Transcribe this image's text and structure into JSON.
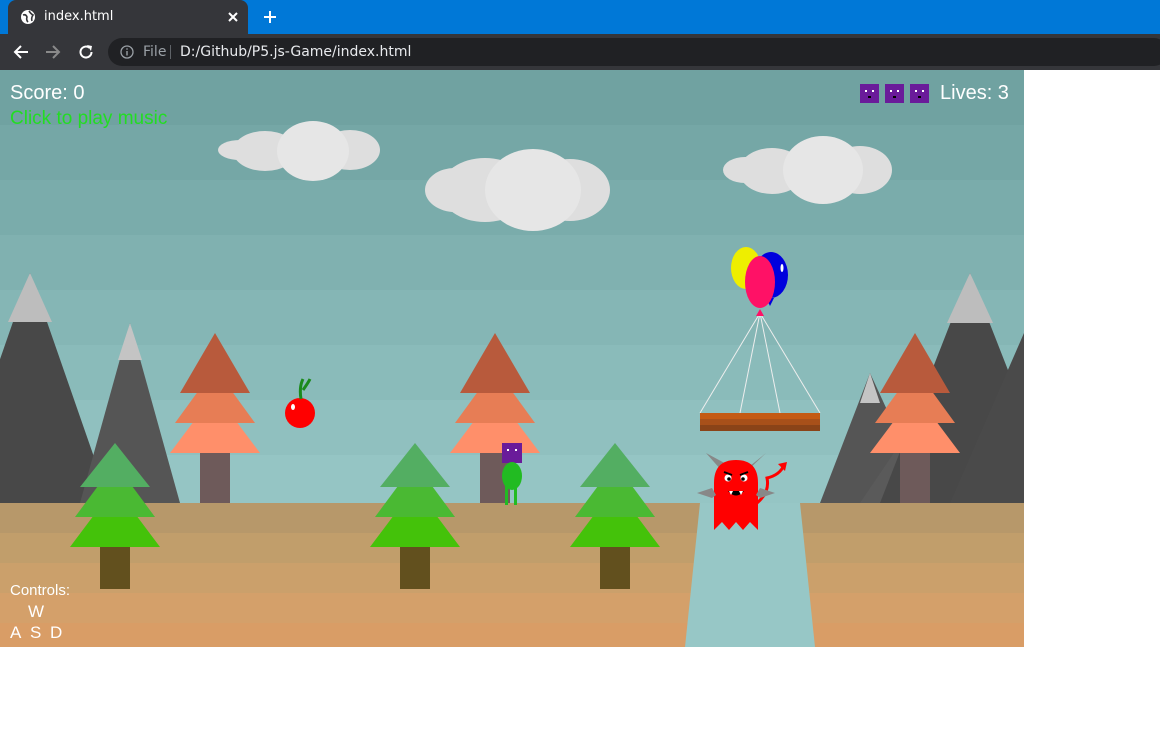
{
  "browser": {
    "tab_title": "index.html",
    "scheme_label": "File",
    "url": "D:/Github/P5.js-Game/index.html",
    "icons": [
      "globe-icon",
      "close-icon",
      "plus-icon",
      "back-arrow-icon",
      "forward-arrow-icon",
      "reload-icon",
      "info-icon"
    ]
  },
  "hud": {
    "score_text": "Score: 0",
    "music_prompt": "Click to play music",
    "lives_text": "Lives: 3",
    "lives_count": 3
  },
  "controls": {
    "title": "Controls:",
    "keys": [
      "W",
      "A",
      "S",
      "D"
    ]
  },
  "colors": {
    "sky_top": "#6fa3a3",
    "ground": "#c9a06e",
    "player_head": "#6a1b9a",
    "player_body": "#22bb22",
    "enemy": "#ff0000",
    "music_prompt": "#22dd22",
    "canyon_water": "#97c7c6",
    "balloons": [
      "#eeee00",
      "#0000dd",
      "#ff1166"
    ]
  },
  "scene": {
    "collectable": "apple",
    "platform": "floating-wooden-platform-with-balloons",
    "enemy": "red-horned-devil",
    "hazard": "canyon"
  }
}
